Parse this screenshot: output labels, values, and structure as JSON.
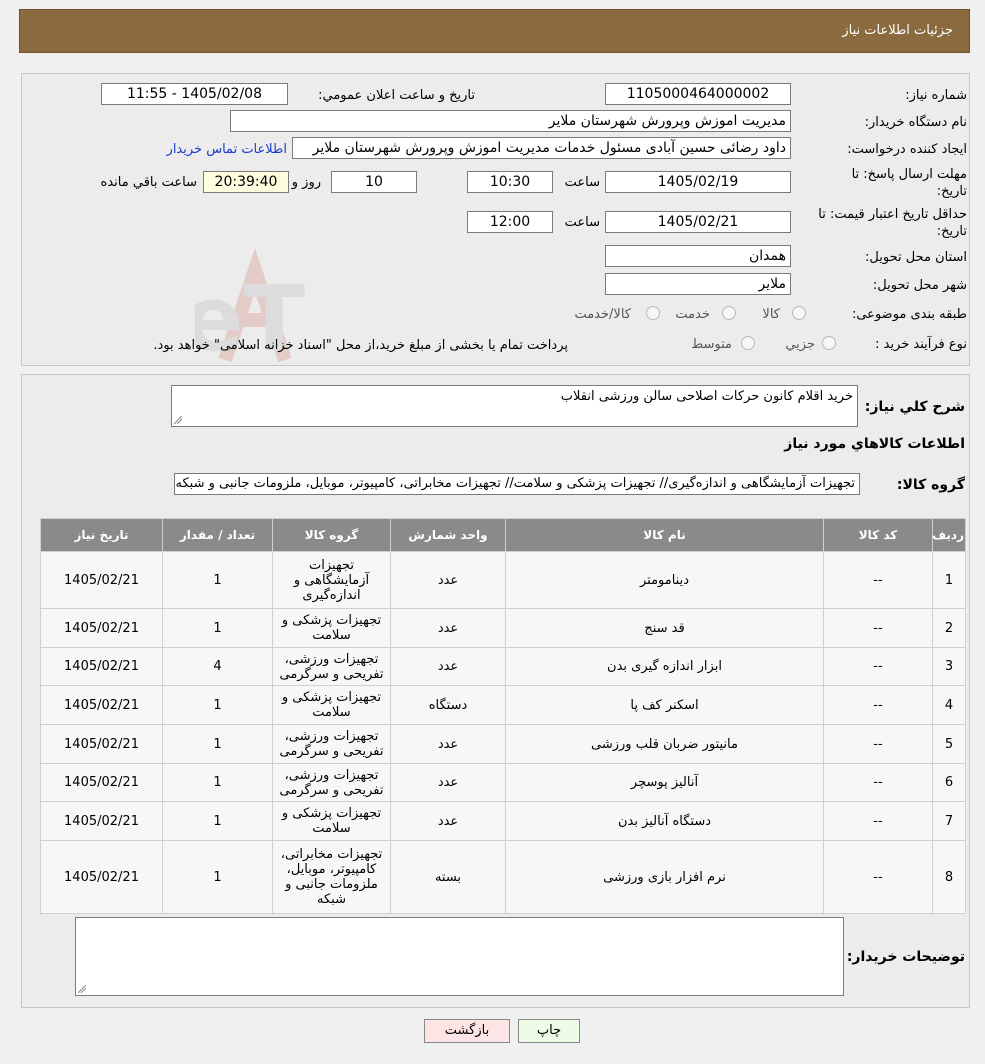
{
  "header": {
    "title": "جزئیات اطلاعات نیاز"
  },
  "info": {
    "need_number_label": "شماره نیاز:",
    "need_number": "1105000464000002",
    "announce_label": "تاریخ و ساعت اعلان عمومي:",
    "announce_value": "1405/02/08 - 11:55",
    "buyer_label": "نام دستگاه خریدار:",
    "buyer_value": "مدیریت اموزش وپرورش شهرستان ملایر",
    "creator_label": "ایجاد کننده درخواست:",
    "creator_value": "داود رضائی حسین آبادی مسئول خدمات مدیریت اموزش وپرورش شهرستان ملایر",
    "contact_link": "اطلاعات تماس خریدار",
    "deadline_label_1": "مهلت ارسال پاسخ: تا",
    "deadline_label_2": "تاریخ:",
    "deadline_date": "1405/02/19",
    "time_word": "ساعت",
    "deadline_time": "10:30",
    "days_value": "10",
    "days_word": "روز و",
    "remaining_time": "20:39:40",
    "remaining_word": "ساعت باقي مانده",
    "validity_label_1": "حداقل تاریخ اعتبار قیمت: تا",
    "validity_label_2": "تاریخ:",
    "validity_date": "1405/02/21",
    "validity_time": "12:00",
    "province_label": "استان محل تحویل:",
    "province_value": "همدان",
    "city_label": "شهر محل تحویل:",
    "city_value": "ملایر",
    "category_label": "طبقه بندی موضوعی:",
    "category_options": [
      "کالا",
      "خدمت",
      "کالا/خدمت"
    ],
    "process_label": "نوع فرآیند خرید :",
    "process_options": [
      "جزیي",
      "متوسط"
    ],
    "process_note": "پرداخت تمام یا بخشی از مبلغ خرید،از محل \"اسناد خزانه اسلامی\" خواهد بود."
  },
  "watermark": "AriaTender.neT",
  "details": {
    "summary_label": "شرح کلي نیاز:",
    "summary_value": "خرید اقلام کانون حرکات اصلاحی سالن ورزشی انقلاب",
    "goods_info_title": "اطلاعات کالاهاي مورد نیاز",
    "goods_group_label": "گروه کالا:",
    "goods_group_value": "تجهیزات آزمایشگاهی و اندازه‌گیری// تجهیزات پزشکی و سلامت// تجهیزات مخابراتی، کامپیوتر، موبایل، ملزومات جانبی و شبکه"
  },
  "table": {
    "headers": [
      "ردیف",
      "کد کالا",
      "نام کالا",
      "واحد شمارش",
      "گروه کالا",
      "تعداد / مقدار",
      "تاریخ نیاز"
    ],
    "rows": [
      [
        "1",
        "--",
        "دینامومتر",
        "عدد",
        "تجهیزات آزمایشگاهی و اندازه‌گیری",
        "1",
        "1405/02/21"
      ],
      [
        "2",
        "--",
        "قد سنج",
        "عدد",
        "تجهیزات پزشکی و سلامت",
        "1",
        "1405/02/21"
      ],
      [
        "3",
        "--",
        "ابزار اندازه گیری بدن",
        "عدد",
        "تجهیزات ورزشی، تفریحی و سرگرمی",
        "4",
        "1405/02/21"
      ],
      [
        "4",
        "--",
        "اسکنر کف پا",
        "دستگاه",
        "تجهیزات پزشکی و سلامت",
        "1",
        "1405/02/21"
      ],
      [
        "5",
        "--",
        "مانیتور ضربان قلب ورزشی",
        "عدد",
        "تجهیزات ورزشی، تفریحی و سرگرمی",
        "1",
        "1405/02/21"
      ],
      [
        "6",
        "--",
        "آنالیز پوسچر",
        "عدد",
        "تجهیزات ورزشی، تفریحی و سرگرمی",
        "1",
        "1405/02/21"
      ],
      [
        "7",
        "--",
        "دستگاه آنالیز بدن",
        "عدد",
        "تجهیزات پزشکی و سلامت",
        "1",
        "1405/02/21"
      ],
      [
        "8",
        "--",
        "نرم افزار بازی ورزشی",
        "بسته",
        "تجهیزات مخابراتی، کامپیوتر، موبایل، ملزومات جانبی و شبکه",
        "1",
        "1405/02/21"
      ]
    ]
  },
  "buyer_notes": {
    "label": "توضیحات خریدار:",
    "value": ""
  },
  "buttons": {
    "print": "چاپ",
    "back": "بازگشت"
  }
}
